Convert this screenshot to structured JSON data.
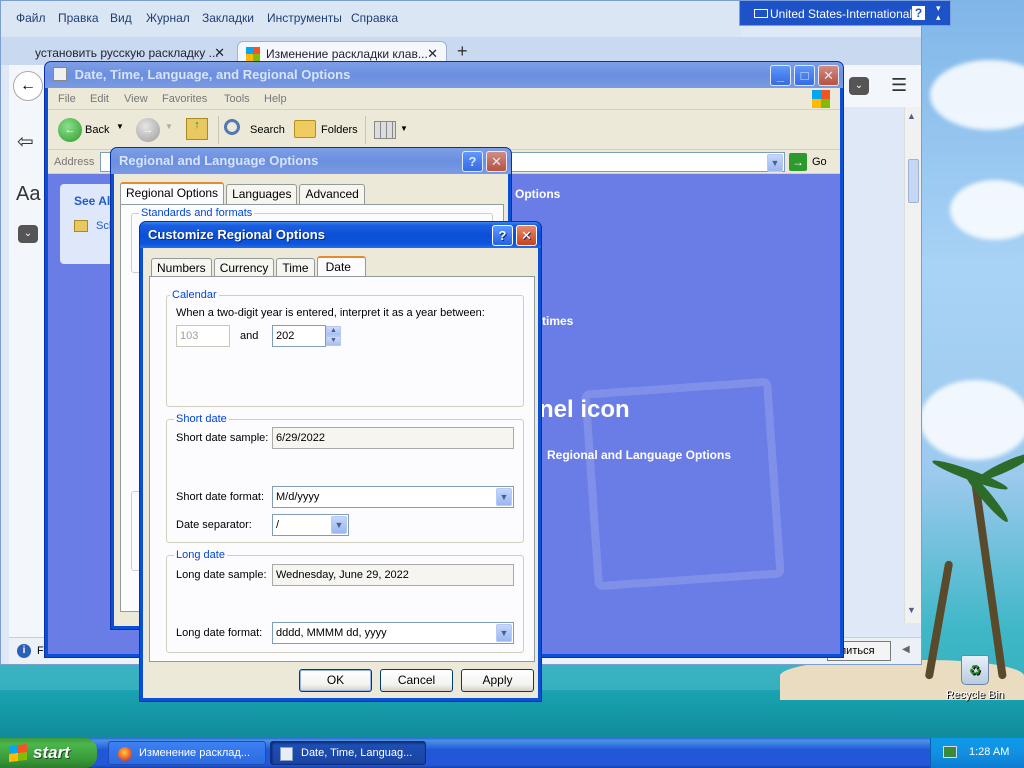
{
  "firefox": {
    "menu": [
      "Файл",
      "Правка",
      "Вид",
      "Журнал",
      "Закладки",
      "Инструменты",
      "Справка"
    ],
    "tabs": [
      {
        "label": "установить русскую раскладку ..."
      },
      {
        "label": "Изменение раскладки клав..."
      }
    ],
    "new_tab": "+",
    "share_button": "елиться",
    "side_aa": "Aa"
  },
  "language_bar": {
    "label": "United States-International",
    "help": "?"
  },
  "control_panel": {
    "title": "Date, Time, Language, and Regional Options",
    "menu": [
      "File",
      "Edit",
      "View",
      "Favorites",
      "Tools",
      "Help"
    ],
    "toolbar": {
      "back": "Back",
      "search": "Search",
      "folders": "Folders"
    },
    "address_label": "Address",
    "go": "Go",
    "see_also": "See Al",
    "see_also_item": "Sch",
    "content": {
      "options_fragment": "Options",
      "times_fragment": "times",
      "icon_fragment": "nel icon",
      "rlo_link": "Regional and Language Options"
    },
    "status_fragment": "F"
  },
  "regional_dialog": {
    "title": "Regional and Language Options",
    "tabs": [
      "Regional Options",
      "Languages",
      "Advanced"
    ],
    "group": "Standards and formats"
  },
  "customize_dialog": {
    "title": "Customize Regional Options",
    "tabs": [
      "Numbers",
      "Currency",
      "Time",
      "Date"
    ],
    "calendar": {
      "group": "Calendar",
      "instruction": "When a two-digit year is entered, interpret it as a year between:",
      "from_year": "103",
      "and_label": "and",
      "to_year": "202"
    },
    "short_date": {
      "group": "Short date",
      "sample_label": "Short date sample:",
      "sample_value": "6/29/2022",
      "format_label": "Short date format:",
      "format_value": "M/d/yyyy",
      "separator_label": "Date separator:",
      "separator_value": "/"
    },
    "long_date": {
      "group": "Long date",
      "sample_label": "Long date sample:",
      "sample_value": "Wednesday, June 29, 2022",
      "format_label": "Long date format:",
      "format_value": "dddd, MMMM dd, yyyy"
    },
    "buttons": {
      "ok": "OK",
      "cancel": "Cancel",
      "apply": "Apply"
    }
  },
  "desktop": {
    "recycle_bin": "Recycle Bin"
  },
  "taskbar": {
    "start": "start",
    "tasks": [
      "Изменение расклад...",
      "Date, Time, Languag..."
    ],
    "clock": "1:28 AM"
  }
}
